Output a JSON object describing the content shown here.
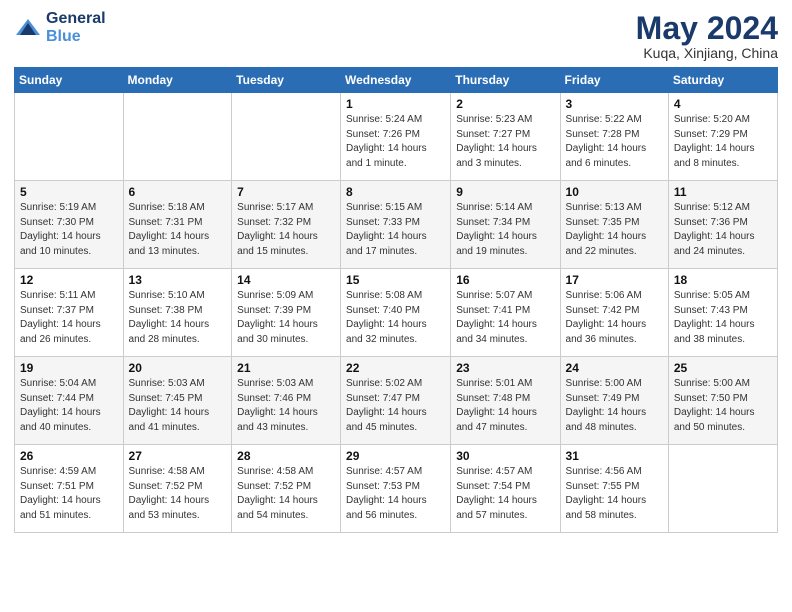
{
  "header": {
    "logo_line1": "General",
    "logo_line2": "Blue",
    "title": "May 2024",
    "location": "Kuqa, Xinjiang, China"
  },
  "calendar": {
    "columns": [
      "Sunday",
      "Monday",
      "Tuesday",
      "Wednesday",
      "Thursday",
      "Friday",
      "Saturday"
    ],
    "rows": [
      [
        {
          "day": "",
          "info": ""
        },
        {
          "day": "",
          "info": ""
        },
        {
          "day": "",
          "info": ""
        },
        {
          "day": "1",
          "info": "Sunrise: 5:24 AM\nSunset: 7:26 PM\nDaylight: 14 hours\nand 1 minute."
        },
        {
          "day": "2",
          "info": "Sunrise: 5:23 AM\nSunset: 7:27 PM\nDaylight: 14 hours\nand 3 minutes."
        },
        {
          "day": "3",
          "info": "Sunrise: 5:22 AM\nSunset: 7:28 PM\nDaylight: 14 hours\nand 6 minutes."
        },
        {
          "day": "4",
          "info": "Sunrise: 5:20 AM\nSunset: 7:29 PM\nDaylight: 14 hours\nand 8 minutes."
        }
      ],
      [
        {
          "day": "5",
          "info": "Sunrise: 5:19 AM\nSunset: 7:30 PM\nDaylight: 14 hours\nand 10 minutes."
        },
        {
          "day": "6",
          "info": "Sunrise: 5:18 AM\nSunset: 7:31 PM\nDaylight: 14 hours\nand 13 minutes."
        },
        {
          "day": "7",
          "info": "Sunrise: 5:17 AM\nSunset: 7:32 PM\nDaylight: 14 hours\nand 15 minutes."
        },
        {
          "day": "8",
          "info": "Sunrise: 5:15 AM\nSunset: 7:33 PM\nDaylight: 14 hours\nand 17 minutes."
        },
        {
          "day": "9",
          "info": "Sunrise: 5:14 AM\nSunset: 7:34 PM\nDaylight: 14 hours\nand 19 minutes."
        },
        {
          "day": "10",
          "info": "Sunrise: 5:13 AM\nSunset: 7:35 PM\nDaylight: 14 hours\nand 22 minutes."
        },
        {
          "day": "11",
          "info": "Sunrise: 5:12 AM\nSunset: 7:36 PM\nDaylight: 14 hours\nand 24 minutes."
        }
      ],
      [
        {
          "day": "12",
          "info": "Sunrise: 5:11 AM\nSunset: 7:37 PM\nDaylight: 14 hours\nand 26 minutes."
        },
        {
          "day": "13",
          "info": "Sunrise: 5:10 AM\nSunset: 7:38 PM\nDaylight: 14 hours\nand 28 minutes."
        },
        {
          "day": "14",
          "info": "Sunrise: 5:09 AM\nSunset: 7:39 PM\nDaylight: 14 hours\nand 30 minutes."
        },
        {
          "day": "15",
          "info": "Sunrise: 5:08 AM\nSunset: 7:40 PM\nDaylight: 14 hours\nand 32 minutes."
        },
        {
          "day": "16",
          "info": "Sunrise: 5:07 AM\nSunset: 7:41 PM\nDaylight: 14 hours\nand 34 minutes."
        },
        {
          "day": "17",
          "info": "Sunrise: 5:06 AM\nSunset: 7:42 PM\nDaylight: 14 hours\nand 36 minutes."
        },
        {
          "day": "18",
          "info": "Sunrise: 5:05 AM\nSunset: 7:43 PM\nDaylight: 14 hours\nand 38 minutes."
        }
      ],
      [
        {
          "day": "19",
          "info": "Sunrise: 5:04 AM\nSunset: 7:44 PM\nDaylight: 14 hours\nand 40 minutes."
        },
        {
          "day": "20",
          "info": "Sunrise: 5:03 AM\nSunset: 7:45 PM\nDaylight: 14 hours\nand 41 minutes."
        },
        {
          "day": "21",
          "info": "Sunrise: 5:03 AM\nSunset: 7:46 PM\nDaylight: 14 hours\nand 43 minutes."
        },
        {
          "day": "22",
          "info": "Sunrise: 5:02 AM\nSunset: 7:47 PM\nDaylight: 14 hours\nand 45 minutes."
        },
        {
          "day": "23",
          "info": "Sunrise: 5:01 AM\nSunset: 7:48 PM\nDaylight: 14 hours\nand 47 minutes."
        },
        {
          "day": "24",
          "info": "Sunrise: 5:00 AM\nSunset: 7:49 PM\nDaylight: 14 hours\nand 48 minutes."
        },
        {
          "day": "25",
          "info": "Sunrise: 5:00 AM\nSunset: 7:50 PM\nDaylight: 14 hours\nand 50 minutes."
        }
      ],
      [
        {
          "day": "26",
          "info": "Sunrise: 4:59 AM\nSunset: 7:51 PM\nDaylight: 14 hours\nand 51 minutes."
        },
        {
          "day": "27",
          "info": "Sunrise: 4:58 AM\nSunset: 7:52 PM\nDaylight: 14 hours\nand 53 minutes."
        },
        {
          "day": "28",
          "info": "Sunrise: 4:58 AM\nSunset: 7:52 PM\nDaylight: 14 hours\nand 54 minutes."
        },
        {
          "day": "29",
          "info": "Sunrise: 4:57 AM\nSunset: 7:53 PM\nDaylight: 14 hours\nand 56 minutes."
        },
        {
          "day": "30",
          "info": "Sunrise: 4:57 AM\nSunset: 7:54 PM\nDaylight: 14 hours\nand 57 minutes."
        },
        {
          "day": "31",
          "info": "Sunrise: 4:56 AM\nSunset: 7:55 PM\nDaylight: 14 hours\nand 58 minutes."
        },
        {
          "day": "",
          "info": ""
        }
      ]
    ]
  }
}
